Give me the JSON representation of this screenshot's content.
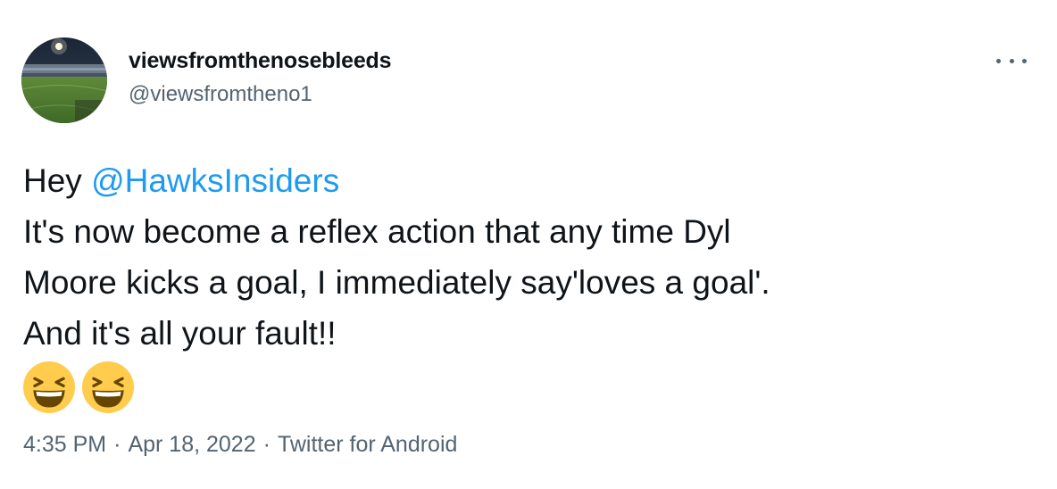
{
  "tweet": {
    "author": {
      "display_name": "viewsfromthenosebleeds",
      "handle": "@viewsfromtheno1"
    },
    "more_icon": "more-horizontal-icon",
    "text": {
      "greeting": "Hey ",
      "mention": "@HawksInsiders",
      "line2": "It's now become a reflex action that any time Dyl",
      "line3": "Moore kicks a goal, I immediately say'loves a goal'.",
      "line4": "And it's all your fault!!",
      "emojis": [
        "grinning-squinting-face",
        "grinning-squinting-face"
      ]
    },
    "meta": {
      "time": "4:35 PM",
      "separator": "·",
      "date": "Apr 18, 2022",
      "source": "Twitter for Android"
    },
    "colors": {
      "text": "#0f1419",
      "secondary": "#536471",
      "link": "#1d9bf0",
      "emoji_face": "#ffcc4d"
    }
  }
}
